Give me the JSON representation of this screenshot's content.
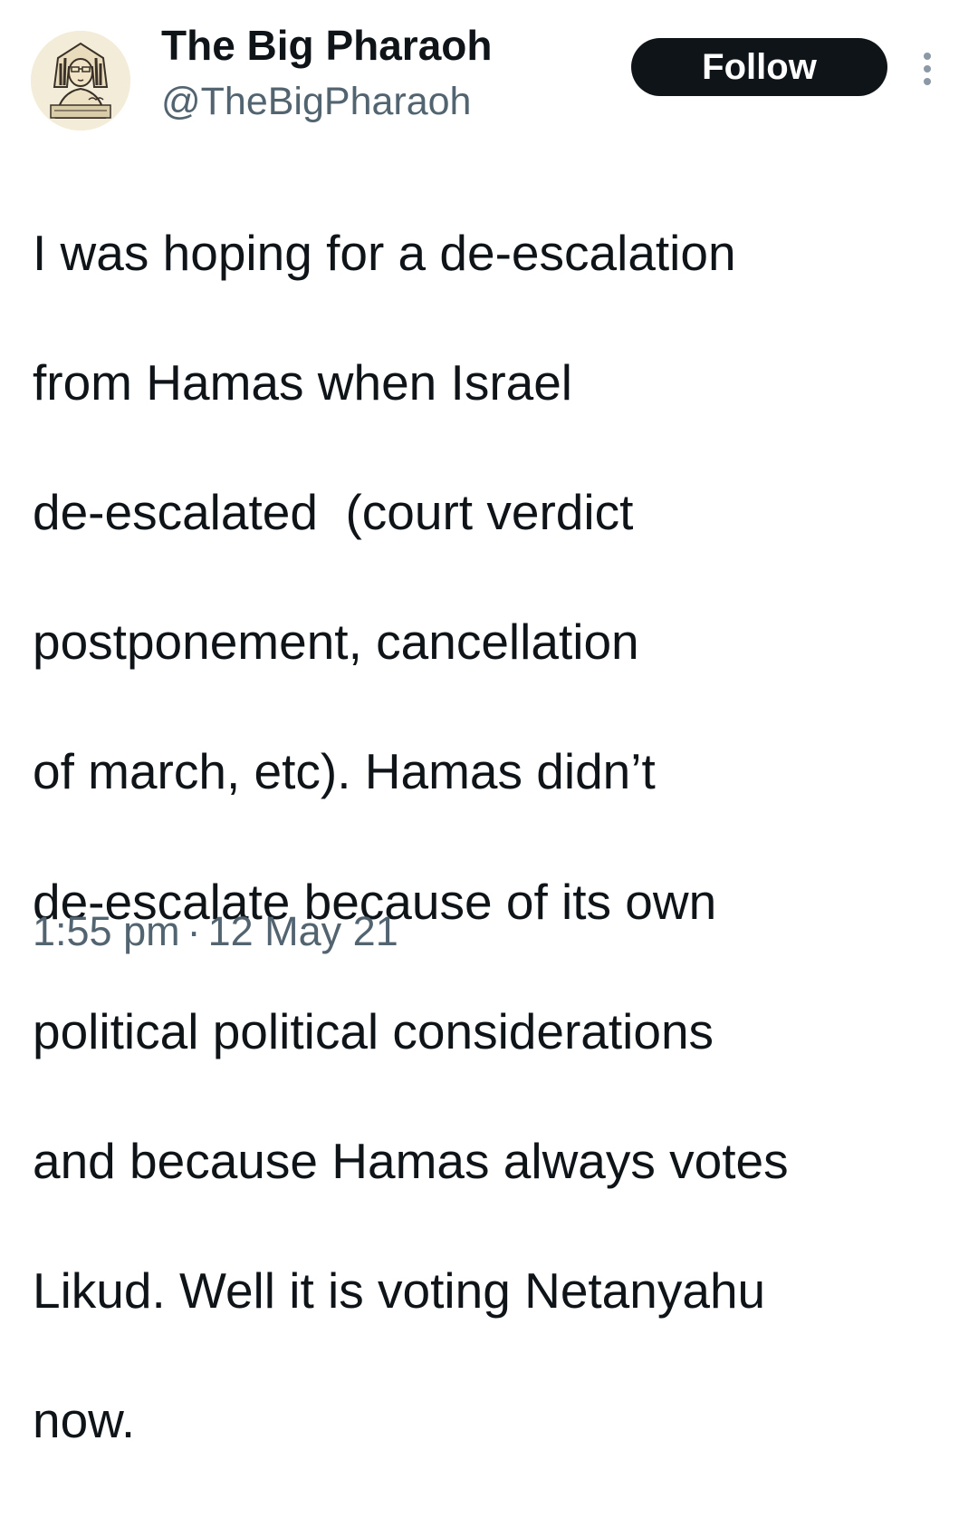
{
  "author": {
    "display_name": "The Big Pharaoh",
    "handle": "@TheBigPharaoh",
    "avatar_icon": "pharaoh-avatar-icon"
  },
  "actions": {
    "follow_label": "Follow",
    "more_icon": "more-options-icon"
  },
  "tweet": {
    "lines": [
      "I was hoping for a de-escalation",
      "from Hamas when Israel",
      "de-escalated  (court verdict",
      "postponement, cancellation",
      "of march, etc). Hamas didn’t",
      "de-escalate because of its own",
      "political political considerations",
      "and because Hamas always votes",
      "Likud. Well it is voting Netanyahu",
      "now."
    ],
    "time": "1:55 pm",
    "separator": "·",
    "date": "12 May 21"
  },
  "colors": {
    "text_primary": "#0f1419",
    "text_secondary": "#536471",
    "button_bg": "#0f1419",
    "button_text": "#ffffff"
  }
}
